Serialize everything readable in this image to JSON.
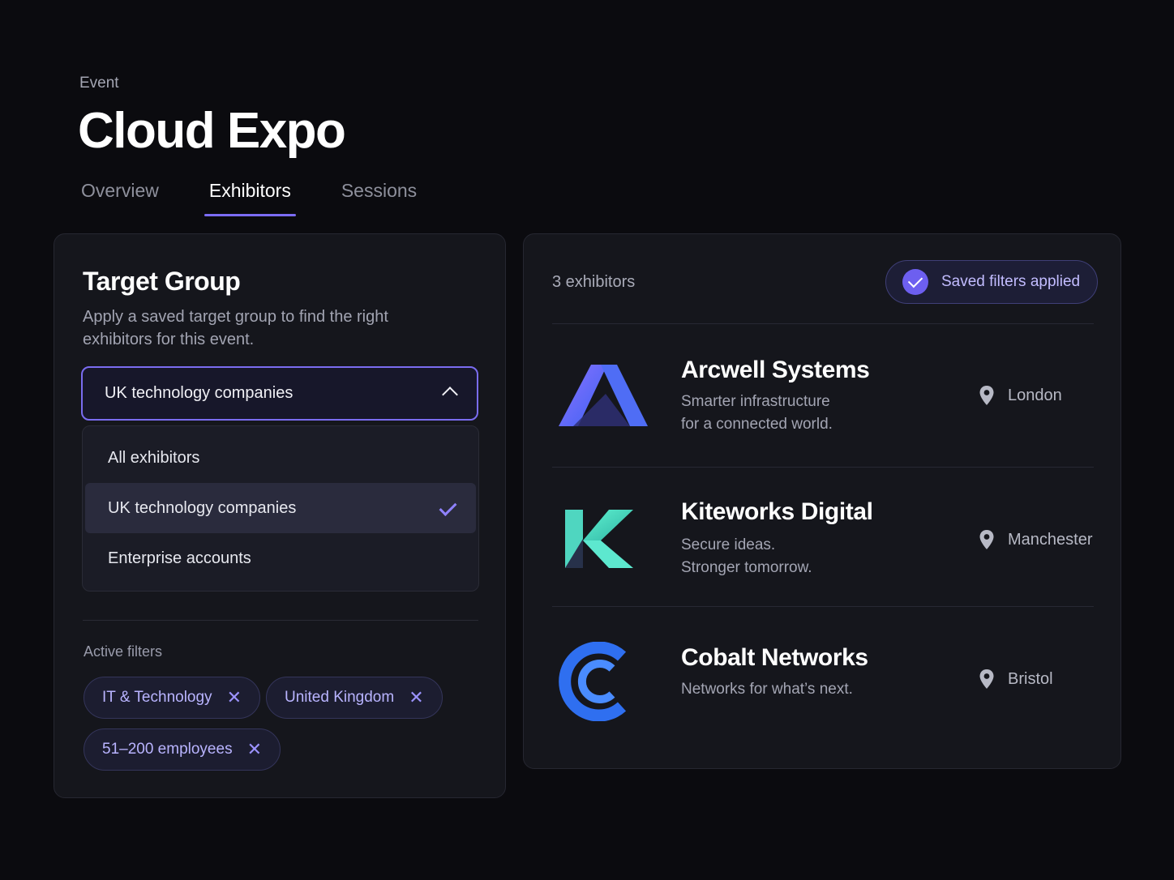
{
  "header": {
    "eyebrow": "Event",
    "title": "Cloud Expo",
    "tabs": [
      {
        "label": "Overview",
        "active": false
      },
      {
        "label": "Exhibitors",
        "active": true
      },
      {
        "label": "Sessions",
        "active": false
      }
    ]
  },
  "target_group": {
    "title": "Target Group",
    "description": "Apply a saved target group to find the right exhibitors for this event.",
    "select": {
      "value": "UK technology companies",
      "expanded": true
    },
    "options": [
      {
        "label": "All exhibitors",
        "selected": false
      },
      {
        "label": "UK technology companies",
        "selected": true
      },
      {
        "label": "Enterprise accounts",
        "selected": false
      }
    ],
    "active_filters_label": "Active filters",
    "filters": [
      {
        "label": "IT & Technology",
        "remove": "✕"
      },
      {
        "label": "United Kingdom",
        "remove": "✕"
      },
      {
        "label": "51–200 employees",
        "remove": "✕"
      }
    ]
  },
  "results": {
    "count_label": "3 exhibitors",
    "saved_pill": "Saved filters applied",
    "exhibitors": [
      {
        "name": "Arcwell Systems",
        "tagline_1": "Smarter infrastructure",
        "tagline_2": "for a connected world.",
        "location": "London",
        "logo": "arcwell-a-logo"
      },
      {
        "name": "Kiteworks Digital",
        "tagline_1": "Secure ideas.",
        "tagline_2": "Stronger tomorrow.",
        "location": "Manchester",
        "logo": "kiteworks-k-logo"
      },
      {
        "name": "Cobalt Networks",
        "tagline_1": "Networks for what’s next.",
        "tagline_2": "",
        "location": "Bristol",
        "logo": "cobalt-c-logo"
      }
    ]
  },
  "colors": {
    "accent": "#7c6cf6",
    "background": "#0b0b0f",
    "panel": "#15161c",
    "chip_text": "#b9b4ff"
  }
}
